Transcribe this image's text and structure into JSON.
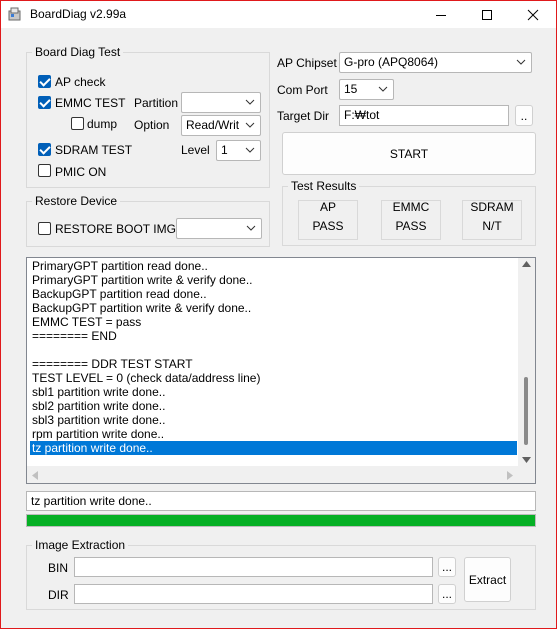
{
  "window": {
    "title": "BoardDiag v2.99a"
  },
  "board_diag": {
    "group_label": "Board Diag Test",
    "ap_check": {
      "label": "AP check",
      "checked": true
    },
    "emmc_test": {
      "label": "EMMC TEST",
      "checked": true
    },
    "dump": {
      "label": "dump",
      "checked": false
    },
    "sdram_test": {
      "label": "SDRAM TEST",
      "checked": true
    },
    "pmic_on": {
      "label": "PMIC ON",
      "checked": false
    },
    "partition_label": "Partition",
    "partition_value": "",
    "option_label": "Option",
    "option_value": "Read/Writ",
    "level_label": "Level",
    "level_value": "1"
  },
  "restore": {
    "group_label": "Restore Device",
    "restore_boot_img": {
      "label": "RESTORE BOOT IMG",
      "checked": false
    },
    "image_value": ""
  },
  "settings": {
    "ap_chipset_label": "AP Chipset",
    "ap_chipset_value": "G-pro (APQ8064)",
    "com_port_label": "Com Port",
    "com_port_value": "15",
    "target_dir_label": "Target Dir",
    "target_dir_value": "F:₩tot",
    "browse_label": "..",
    "start_label": "START"
  },
  "results": {
    "group_label": "Test Results",
    "items": [
      {
        "name": "AP",
        "value": "PASS"
      },
      {
        "name": "EMMC",
        "value": "PASS"
      },
      {
        "name": "SDRAM",
        "value": "N/T"
      }
    ]
  },
  "log": {
    "lines": [
      "PrimaryGPT partition read done..",
      "PrimaryGPT partition write & verify done..",
      "BackupGPT partition read done..",
      "BackupGPT partition write & verify done..",
      "EMMC TEST = pass",
      "======== END",
      "",
      "======== DDR TEST START",
      "TEST LEVEL = 0 (check data/address line)",
      "sbl1 partition write done..",
      "sbl2 partition write done..",
      "sbl3 partition write done..",
      "rpm partition write done..",
      "tz partition write done.."
    ],
    "selected_index": 13
  },
  "status_text": "tz partition write done..",
  "progress": {
    "fraction": 1.0,
    "color": "#06b025"
  },
  "extraction": {
    "group_label": "Image Extraction",
    "bin_label": "BIN",
    "bin_value": "",
    "dir_label": "DIR",
    "dir_value": "",
    "browse_label": "...",
    "extract_label": "Extract"
  },
  "colors": {
    "accent": "#005fb8",
    "selection": "#0078d7",
    "window_border": "#e0191b"
  }
}
